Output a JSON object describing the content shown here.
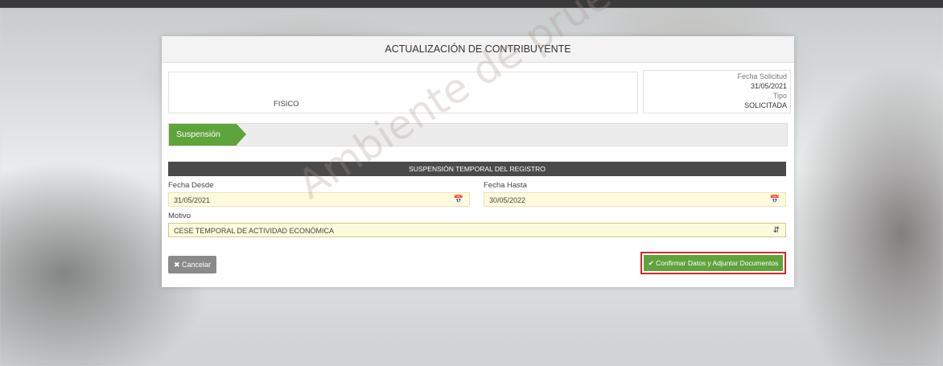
{
  "card": {
    "title": "ACTUALIZACIÓN DE CONTRIBUYENTE"
  },
  "info_left": {
    "tipo_persona": "FISICO"
  },
  "info_right": {
    "fecha_label": "Fecha Solicitud",
    "fecha_value": "31/05/2021",
    "tipo_label": "Tipo",
    "tipo_value": "SOLICITADA"
  },
  "step": {
    "label": "Suspensión"
  },
  "section": {
    "title": "SUSPENSIÓN TEMPORAL DEL REGISTRO"
  },
  "form": {
    "fecha_desde_label": "Fecha Desde",
    "fecha_desde_value": "31/05/2021",
    "fecha_hasta_label": "Fecha Hasta",
    "fecha_hasta_value": "30/05/2022",
    "motivo_label": "Motivo",
    "motivo_value": "CESE TEMPORAL DE ACTIVIDAD ECONÓMICA"
  },
  "buttons": {
    "cancel_label": "✖ Cancelar",
    "confirm_label": "✔ Confirmar Datos y Adjuntar Documentos"
  },
  "watermark": {
    "text": "Ambiente de pruebas"
  },
  "icons": {
    "calendar": "calendar-icon",
    "select": "select-arrows-icon"
  },
  "colors": {
    "accent_green": "#5fa33b",
    "highlight_red": "#d0282e",
    "input_yellow": "#fdfbdc"
  }
}
